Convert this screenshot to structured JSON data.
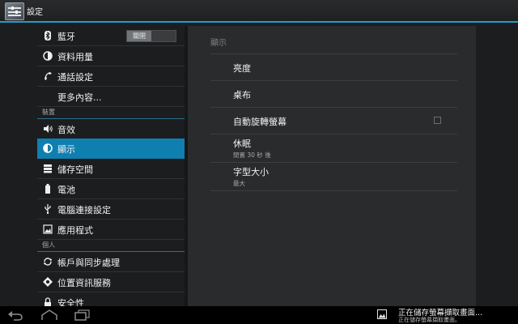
{
  "actionbar": {
    "title": "設定",
    "app_icon": "settings-icon"
  },
  "accent_color": "#1e9ed0",
  "selected_color": "#0f7fb0",
  "sidebar": {
    "bluetooth": {
      "label": "藍牙",
      "icon": "bluetooth-icon",
      "toggle_label": "關閉"
    },
    "data_usage": {
      "label": "資料用量",
      "icon": "data-usage-icon"
    },
    "call_settings": {
      "label": "通話設定",
      "icon": "phone-icon"
    },
    "more": {
      "label": "更多內容..."
    },
    "section_device": "裝置",
    "sound": {
      "label": "音效",
      "icon": "speaker-icon"
    },
    "display": {
      "label": "顯示",
      "icon": "display-icon"
    },
    "storage": {
      "label": "儲存空間",
      "icon": "storage-icon"
    },
    "battery": {
      "label": "電池",
      "icon": "battery-icon"
    },
    "pc_connection": {
      "label": "電腦連接設定",
      "icon": "usb-icon"
    },
    "apps": {
      "label": "應用程式",
      "icon": "apps-icon"
    },
    "section_personal": "個人",
    "accounts_sync": {
      "label": "帳戶與同步處理",
      "icon": "sync-icon"
    },
    "location": {
      "label": "位置資訊服務",
      "icon": "location-icon"
    },
    "security": {
      "label": "安全性",
      "icon": "lock-icon"
    }
  },
  "main": {
    "title": "顯示",
    "brightness": {
      "title": "亮度"
    },
    "wallpaper": {
      "title": "桌布"
    },
    "auto_rotate": {
      "title": "自動旋轉螢幕",
      "checked": false
    },
    "sleep": {
      "title": "休眠",
      "summary": "閒置 30 秒 後"
    },
    "font_size": {
      "title": "字型大小",
      "summary": "最大"
    }
  },
  "navbar": {
    "back": "back-icon",
    "home": "home-icon",
    "recents": "recents-icon"
  },
  "notification": {
    "icon": "image-icon",
    "title": "正在儲存螢幕擷取畫面...",
    "text": "正在儲存螢幕擷取畫面。"
  }
}
